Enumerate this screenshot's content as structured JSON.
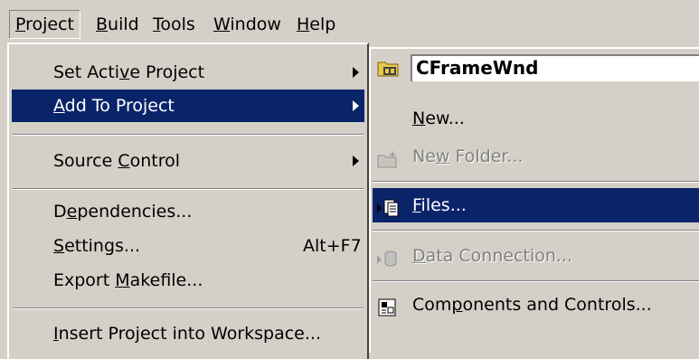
{
  "menubar": {
    "items": [
      {
        "name": "menu-project",
        "pre": "",
        "u": "P",
        "post": "roject"
      },
      {
        "name": "menu-build",
        "pre": "",
        "u": "B",
        "post": "uild"
      },
      {
        "name": "menu-tools",
        "pre": "",
        "u": "T",
        "post": "ools"
      },
      {
        "name": "menu-window",
        "pre": "",
        "u": "W",
        "post": "indow"
      },
      {
        "name": "menu-help",
        "pre": "",
        "u": "H",
        "post": "elp"
      }
    ]
  },
  "project_menu": {
    "set_active": {
      "pre": "Set Acti",
      "u": "v",
      "post": "e Project"
    },
    "add_to_project": {
      "pre": "",
      "u": "A",
      "post": "dd To Project"
    },
    "source_control": {
      "pre": "Source ",
      "u": "C",
      "post": "ontrol"
    },
    "dependencies": {
      "pre": "D",
      "u": "e",
      "post": "pendencies..."
    },
    "settings": {
      "pre": "",
      "u": "S",
      "post": "ettings...",
      "shortcut": "Alt+F7"
    },
    "export_makefile": {
      "pre": "Export ",
      "u": "M",
      "post": "akefile..."
    },
    "insert_project": {
      "pre": "",
      "u": "I",
      "post": "nsert Project into Workspace..."
    }
  },
  "add_submenu": {
    "target_project": "CFrameWnd",
    "new": {
      "pre": "",
      "u": "N",
      "post": "ew..."
    },
    "new_folder": {
      "pre": "Ne",
      "u": "w",
      "post": " Folder..."
    },
    "files": {
      "pre": "",
      "u": "F",
      "post": "iles..."
    },
    "data_connection": {
      "pre": "",
      "u": "D",
      "post": "ata Connection..."
    },
    "components": {
      "pre": "Com",
      "u": "p",
      "post": "onents and Controls..."
    }
  },
  "colors": {
    "highlight": "#0a246a",
    "face": "#d4d0c8"
  },
  "icons": {
    "project_selector": "project-folder-icon",
    "new_folder": "new-folder-icon",
    "files": "files-icon",
    "data_connection": "data-connection-icon",
    "components": "components-icon"
  }
}
